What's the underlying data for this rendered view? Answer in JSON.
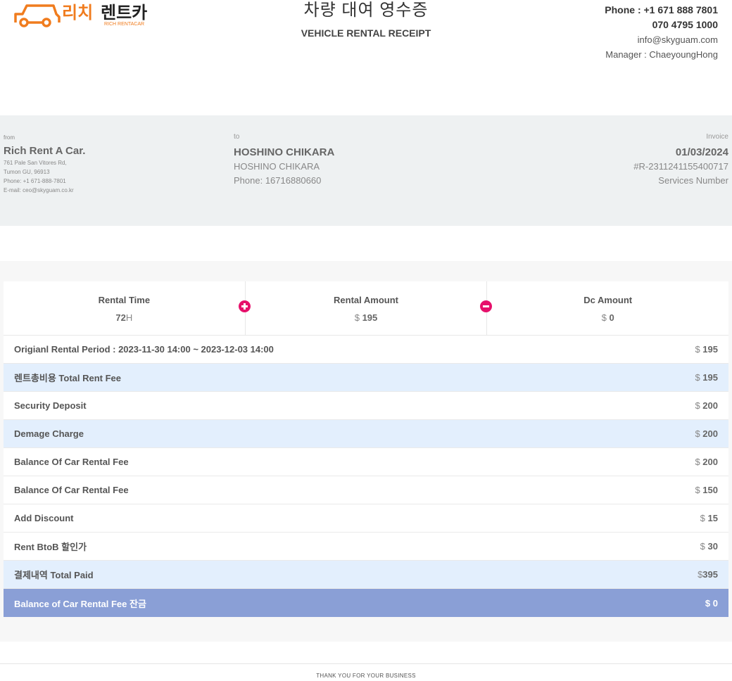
{
  "brand": {
    "name_ko": "리치렌트카",
    "name_en": "RICH RENTACAR",
    "color": "#f07c1e"
  },
  "header": {
    "title_ko": "차량 대여 영수증",
    "title_en": "VEHICLE RENTAL RECEIPT"
  },
  "contact": {
    "phone1": "Phone : +1 671 888 7801",
    "phone2": "070 4795 1000",
    "email": "info@skyguam.com",
    "manager": "Manager : ChaeyoungHong"
  },
  "from": {
    "label": "from",
    "name": "Rich Rent A Car.",
    "address1": "761 Pale San Vitores Rd,",
    "address2": "Tumon GU, 96913",
    "phone": "Phone: +1 671-888-7801",
    "email": "E-mail: ceo@skyguam.co.kr"
  },
  "to": {
    "label": "to",
    "name": "HOSHINO CHIKARA",
    "name2": "HOSHINO CHIKARA",
    "phone": "Phone: 16716880660"
  },
  "invoice": {
    "label": "Invoice",
    "date": "01/03/2024",
    "number": "#R-2311241155400717",
    "services": "Services Number"
  },
  "summary": {
    "rental_time_label": "Rental Time",
    "rental_time_value": "72",
    "rental_time_unit": "H",
    "rental_amount_label": "Rental Amount",
    "rental_amount_currency": "$",
    "rental_amount_value": "195",
    "dc_amount_label": "Dc Amount",
    "dc_amount_currency": "$",
    "dc_amount_value": "0"
  },
  "rows": [
    {
      "label": "Origianl Rental Period : 2023-11-30 14:00 ~ 2023-12-03 14:00",
      "currency": "$",
      "value": "195"
    },
    {
      "label": "렌트총비용 Total Rent Fee",
      "currency": "$",
      "value": "195"
    },
    {
      "label": "Security Deposit",
      "currency": "$",
      "value": "200"
    },
    {
      "label": "Demage Charge",
      "currency": "$",
      "value": "200"
    },
    {
      "label": "Balance Of Car Rental Fee",
      "currency": "$",
      "value": "200"
    },
    {
      "label": "Balance Of Car Rental Fee",
      "currency": "$",
      "value": "150"
    },
    {
      "label": "Add Discount",
      "currency": "$",
      "value": "15"
    },
    {
      "label": "Rent BtoB 할인가",
      "currency": "$",
      "value": "30"
    },
    {
      "label": "결제내역 Total Paid",
      "currency": "$",
      "value": "395"
    },
    {
      "label": "Balance of Car Rental Fee 잔금",
      "currency": "$",
      "value": "0"
    }
  ],
  "footer": {
    "text": "THANK YOU FOR YOUR BUSINESS"
  }
}
